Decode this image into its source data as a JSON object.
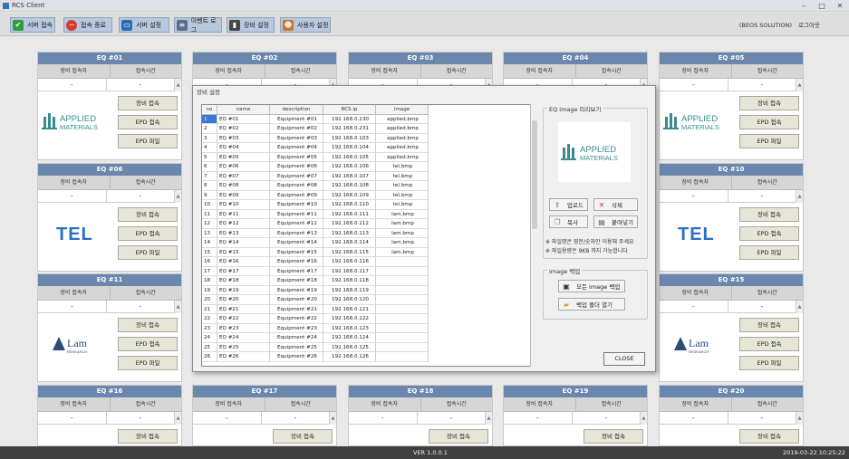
{
  "app": {
    "title": "RCS Client",
    "window_controls": [
      "–",
      "□",
      "✕"
    ]
  },
  "toolbar": {
    "buttons": [
      {
        "label": "서버 접속",
        "icon": "check-icon",
        "color": "#2e9e3f"
      },
      {
        "label": "접속 종료",
        "icon": "stop-icon",
        "color": "#d83a2c"
      },
      {
        "label": "서버 설정",
        "icon": "monitor-icon",
        "color": "#2e6db5"
      },
      {
        "label": "이벤트 로그",
        "icon": "log-icon",
        "color": "#5b6f8a"
      },
      {
        "label": "장비 설정",
        "icon": "server-icon",
        "color": "#474747"
      },
      {
        "label": "사용자 설정",
        "icon": "user-icon",
        "color": "#c27a2c"
      }
    ],
    "company": "(BEOS SOLUTION)",
    "logout": "로그아웃"
  },
  "panel_labels": {
    "col_user": "장비 접속자",
    "col_time": "접속시간",
    "btn_connect": "장비 접속",
    "btn_epd_connect": "EPD 접속",
    "btn_epd_file": "EPD 파일",
    "empty": "-"
  },
  "panels": [
    {
      "id": "EQ #01",
      "vendor": "applied"
    },
    {
      "id": "EQ #02",
      "vendor": "applied"
    },
    {
      "id": "EQ #03",
      "vendor": "applied"
    },
    {
      "id": "EQ #04",
      "vendor": "applied"
    },
    {
      "id": "EQ #05",
      "vendor": "applied"
    },
    {
      "id": "EQ #06",
      "vendor": "tel"
    },
    {
      "id": "EQ #10",
      "vendor": "tel"
    },
    {
      "id": "EQ #11",
      "vendor": "lam"
    },
    {
      "id": "EQ #15",
      "vendor": "lam"
    },
    {
      "id": "EQ #16",
      "vendor": ""
    },
    {
      "id": "EQ #17",
      "vendor": ""
    },
    {
      "id": "EQ #18",
      "vendor": ""
    },
    {
      "id": "EQ #19",
      "vendor": ""
    },
    {
      "id": "EQ #20",
      "vendor": ""
    }
  ],
  "logos": {
    "applied_line1": "APPLIED",
    "applied_line2": "MATERIALS",
    "applied_mark": "®",
    "tel": "TEL",
    "lam": "Lam",
    "lam_sub": "RESEARCH"
  },
  "dialog": {
    "title": "장비 설정",
    "grid": {
      "headers": [
        "no",
        "name",
        "description",
        "RCS ip",
        "image"
      ],
      "rows": [
        [
          "1",
          "EQ #01",
          "Equipment #01",
          "192.168.0.230",
          "applied.bmp"
        ],
        [
          "2",
          "EQ #02",
          "Equipment #02",
          "192.168.0.231",
          "applied.bmp"
        ],
        [
          "3",
          "EQ #03",
          "Equipment #03",
          "192.168.0.103",
          "applied.bmp"
        ],
        [
          "4",
          "EQ #04",
          "Equipment #04",
          "192.168.0.104",
          "applied.bmp"
        ],
        [
          "5",
          "EQ #05",
          "Equipment #05",
          "192.168.0.105",
          "applied.bmp"
        ],
        [
          "6",
          "EQ #06",
          "Equipment #06",
          "192.168.0.106",
          "tel.bmp"
        ],
        [
          "7",
          "EQ #07",
          "Equipment #07",
          "192.168.0.107",
          "tel.bmp"
        ],
        [
          "8",
          "EQ #08",
          "Equipment #08",
          "192.168.0.108",
          "tel.bmp"
        ],
        [
          "9",
          "EQ #09",
          "Equipment #09",
          "192.168.0.109",
          "tel.bmp"
        ],
        [
          "10",
          "EQ #10",
          "Equipment #10",
          "192.168.0.110",
          "tel.bmp"
        ],
        [
          "11",
          "EQ #11",
          "Equipment #11",
          "192.168.0.111",
          "lam.bmp"
        ],
        [
          "12",
          "EQ #12",
          "Equipment #12",
          "192.168.0.112",
          "lam.bmp"
        ],
        [
          "13",
          "EQ #13",
          "Equipment #13",
          "192.168.0.113",
          "lam.bmp"
        ],
        [
          "14",
          "EQ #14",
          "Equipment #14",
          "192.168.0.114",
          "lam.bmp"
        ],
        [
          "15",
          "EQ #15",
          "Equipment #15",
          "192.168.0.115",
          "lam.bmp"
        ],
        [
          "16",
          "EQ #16",
          "Equipment #16",
          "192.168.0.116",
          ""
        ],
        [
          "17",
          "EQ #17",
          "Equipment #17",
          "192.168.0.117",
          ""
        ],
        [
          "18",
          "EQ #18",
          "Equipment #18",
          "192.168.0.118",
          ""
        ],
        [
          "19",
          "EQ #19",
          "Equipment #19",
          "192.168.0.119",
          ""
        ],
        [
          "20",
          "EQ #20",
          "Equipment #20",
          "192.168.0.120",
          ""
        ],
        [
          "21",
          "EQ #21",
          "Equipment #21",
          "192.168.0.121",
          ""
        ],
        [
          "22",
          "EQ #22",
          "Equipment #22",
          "192.168.0.122",
          ""
        ],
        [
          "23",
          "EQ #23",
          "Equipment #23",
          "192.168.0.123",
          ""
        ],
        [
          "24",
          "EQ #24",
          "Equipment #24",
          "192.168.0.124",
          ""
        ],
        [
          "25",
          "EQ #25",
          "Equipment #25",
          "192.168.0.125",
          ""
        ],
        [
          "26",
          "EQ #26",
          "Equipment #26",
          "192.168.0.126",
          ""
        ]
      ]
    },
    "preview_group": "EQ image 미리보기",
    "upload": "업로드",
    "delete": "삭제",
    "copy": "복사",
    "paste": "붙여넣기",
    "note1": "※ 파일명은 영문/숫자만 이용해 주세요",
    "note2": "※ 파일용량은 9KB 까지 가능합니다",
    "backup_group": "image 백업",
    "backup_all": "모든 image 백업",
    "open_backup": "백업 폴더 열기",
    "close": "CLOSE"
  },
  "status": {
    "version": "VER 1.0.0.1",
    "datetime": "2019-03-22 10:25:22"
  }
}
